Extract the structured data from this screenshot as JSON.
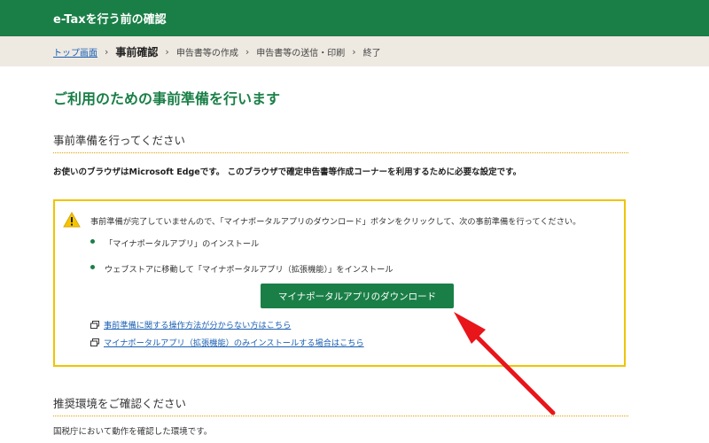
{
  "header": {
    "title": "e-Taxを行う前の確認"
  },
  "breadcrumb": {
    "top_link": "トップ画面",
    "separator": "›",
    "current": "事前確認",
    "steps": [
      "申告書等の作成",
      "申告書等の送信・印刷",
      "終了"
    ]
  },
  "main": {
    "page_title": "ご利用のための事前準備を行います",
    "section1_heading": "事前準備を行ってください",
    "browser_note": "お使いのブラウザはMicrosoft Edgeです。 このブラウザで確定申告書等作成コーナーを利用するために必要な設定です。",
    "warning": {
      "icon": "warning-icon",
      "message": "事前準備が完了していませんので、「マイナポータルアプリのダウンロード」ボタンをクリックして、次の事前準備を行ってください。",
      "bullets": [
        "「マイナポータルアプリ」のインストール",
        "ウェブストアに移動して「マイナポータルアプリ（拡張機能）」をインストール"
      ],
      "download_button": "マイナポータルアプリのダウンロード",
      "links": [
        "事前準備に関する操作方法が分からない方はこちら",
        "マイナポータルアプリ（拡張機能）のみインストールする場合はこちら"
      ]
    },
    "section2_heading": "推奨環境をご確認ください",
    "env_note": "国税庁において動作を確認した環境です。"
  },
  "colors": {
    "brand_green": "#1a7f47",
    "warning_border": "#f0c400",
    "link_blue": "#1a5fb4",
    "annotation_red": "#e8151b"
  }
}
